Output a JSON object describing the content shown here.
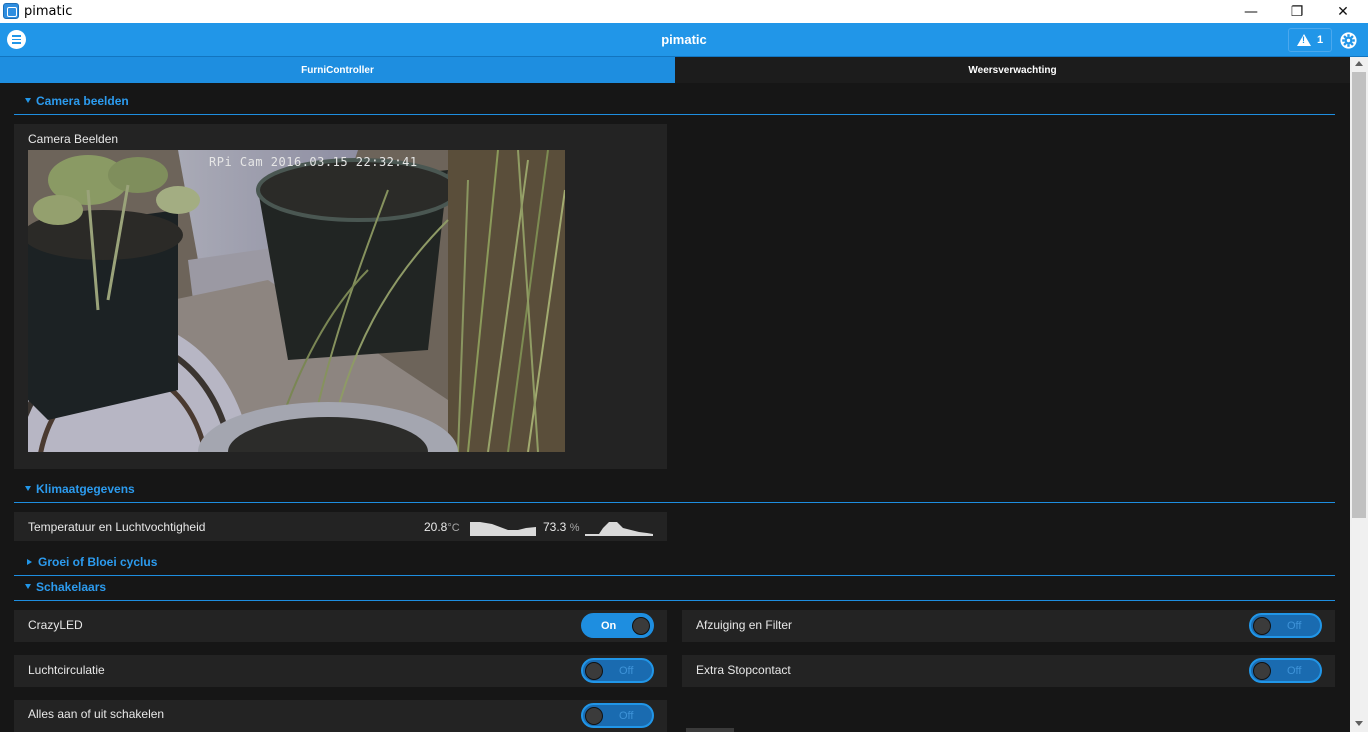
{
  "window": {
    "title": "pimatic",
    "minimize": "—",
    "maximize": "❐",
    "close": "✕"
  },
  "header": {
    "title": "pimatic",
    "alert_count": "1"
  },
  "tabs": [
    {
      "label": "FurniController",
      "active": true
    },
    {
      "label": "Weersverwachting",
      "active": false
    }
  ],
  "sections": {
    "camera": "Camera beelden",
    "climate": "Klimaatgegevens",
    "growth": "Groei of Bloei cyclus",
    "switches": "Schakelaars"
  },
  "camera_card": {
    "label": "Camera Beelden",
    "stamp": "RPi Cam 2016.03.15 22:32:41"
  },
  "climate_card": {
    "label": "Temperatuur en Luchtvochtigheid",
    "temperature": {
      "value": "20.8",
      "unit": "°C"
    },
    "humidity": {
      "value": "73.3",
      "unit": "%"
    }
  },
  "switches": [
    {
      "label": "CrazyLED",
      "state": "On"
    },
    {
      "label": "Afzuiging en Filter",
      "state": "Off"
    },
    {
      "label": "Luchtcirculatie",
      "state": "Off"
    },
    {
      "label": "Extra Stopcontact",
      "state": "Off"
    },
    {
      "label": "Alles aan of uit schakelen",
      "state": "Off"
    }
  ],
  "colors": {
    "accent": "#2196e8",
    "background": "#161616",
    "card": "#232323"
  }
}
